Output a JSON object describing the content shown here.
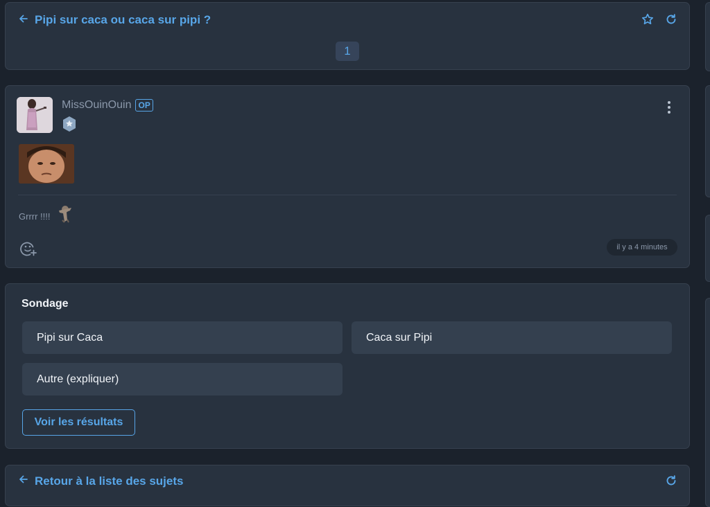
{
  "header": {
    "title": "Pipi sur caca ou caca sur pipi ?",
    "pagination": {
      "pages": [
        "1"
      ],
      "current": "1"
    }
  },
  "post": {
    "author": "MissOuinOuin",
    "op_badge": "OP",
    "text": "Grrrr !!!!",
    "timestamp": "il y a 4 minutes"
  },
  "poll": {
    "title": "Sondage",
    "options": [
      "Pipi sur Caca",
      "Caca sur Pipi",
      "Autre (expliquer)"
    ],
    "results_button": "Voir les résultats"
  },
  "footer": {
    "back_label": "Retour à la liste des sujets"
  },
  "icons": {
    "back": "arrow-left-icon",
    "favorite": "star-icon",
    "refresh": "refresh-icon",
    "menu": "kebab-menu-icon",
    "rank": "rank-star-badge-icon",
    "react": "add-reaction-icon"
  },
  "colors": {
    "background": "#1b222c",
    "card": "#28323f",
    "accent": "#58a6e8",
    "option": "#34404f",
    "muted_text": "#8b98aa"
  }
}
